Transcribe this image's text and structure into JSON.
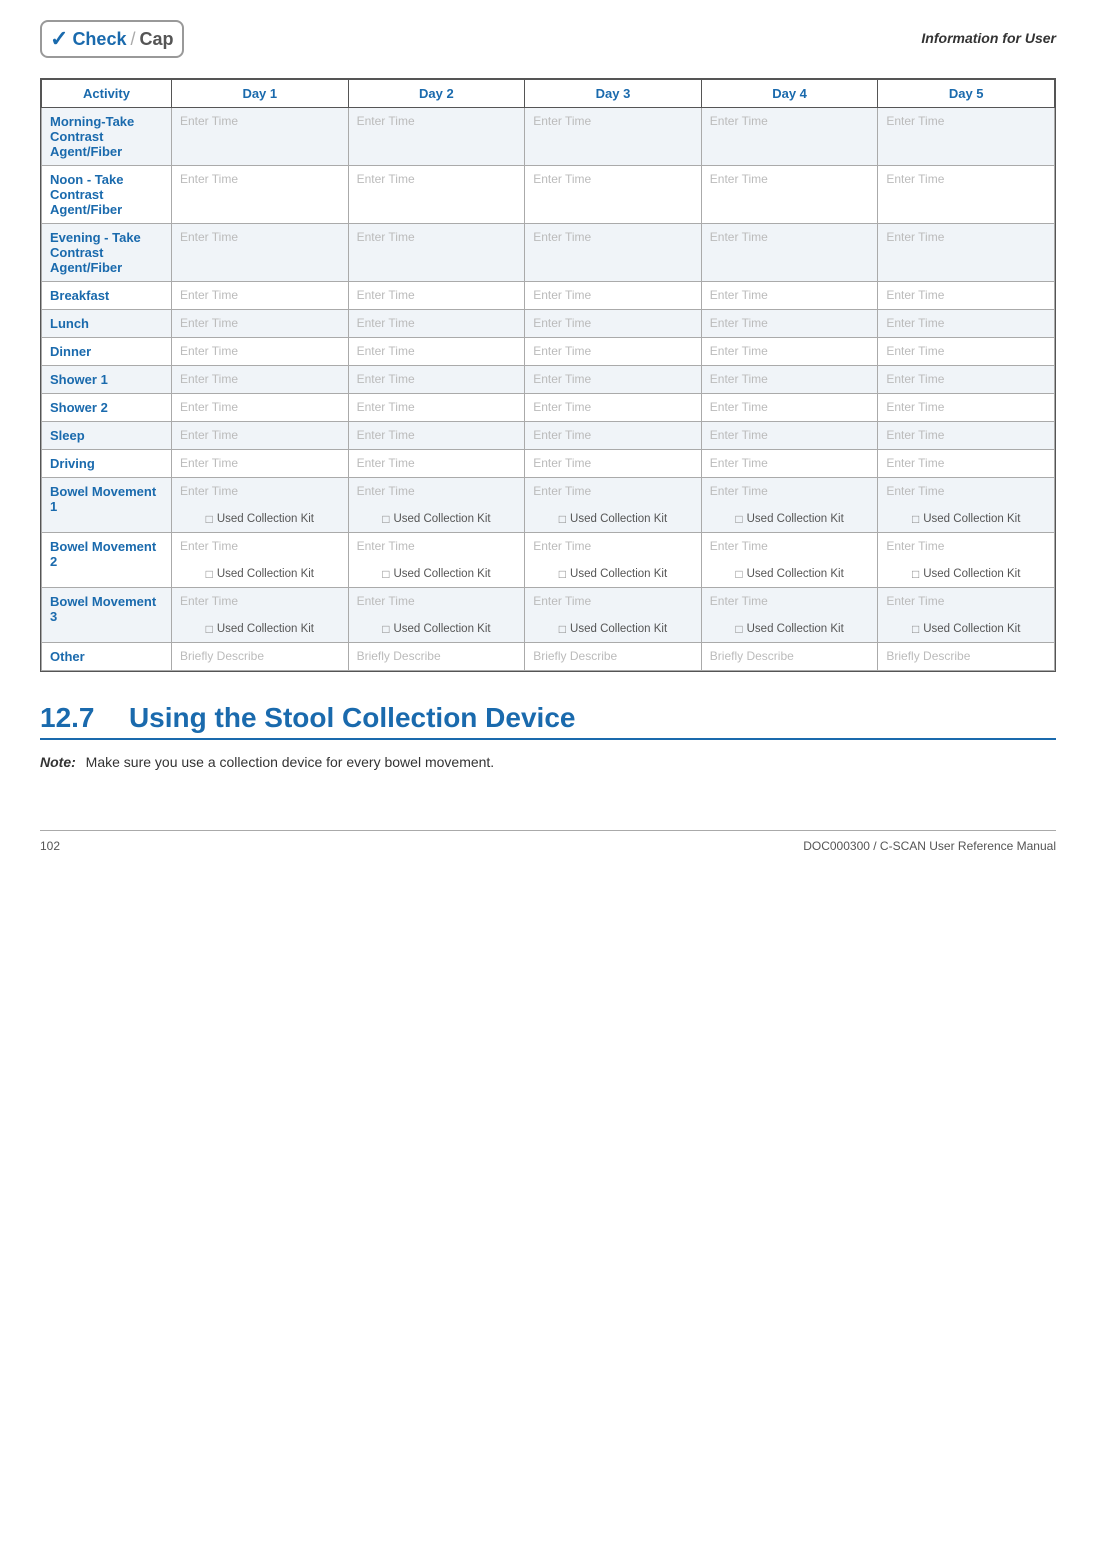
{
  "header": {
    "logo_check": "Check",
    "logo_cap": "Cap",
    "info_label": "Information for User"
  },
  "table": {
    "columns": [
      "Activity",
      "Day 1",
      "Day 2",
      "Day 3",
      "Day 4",
      "Day 5"
    ],
    "placeholder_time": "Enter Time",
    "placeholder_describe": "Briefly Describe",
    "checkbox_label": "Used Collection Kit",
    "rows": [
      {
        "activity": "Morning-Take Contrast Agent/Fiber",
        "shaded": true
      },
      {
        "activity": "Noon - Take Contrast Agent/Fiber",
        "shaded": false
      },
      {
        "activity": "Evening - Take Contrast Agent/Fiber",
        "shaded": true
      },
      {
        "activity": "Breakfast",
        "shaded": false
      },
      {
        "activity": "Lunch",
        "shaded": true
      },
      {
        "activity": "Dinner",
        "shaded": false
      },
      {
        "activity": "Shower 1",
        "shaded": true
      },
      {
        "activity": "Shower 2",
        "shaded": false
      },
      {
        "activity": "Sleep",
        "shaded": true
      },
      {
        "activity": "Driving",
        "shaded": false
      },
      {
        "activity": "Bowel Movement 1",
        "shaded": true,
        "has_checkbox": true
      },
      {
        "activity": "Bowel Movement 2",
        "shaded": false,
        "has_checkbox": true
      },
      {
        "activity": "Bowel Movement 3",
        "shaded": true,
        "has_checkbox": true
      },
      {
        "activity": "Other",
        "shaded": false,
        "is_describe": true
      }
    ]
  },
  "section": {
    "number": "12.7",
    "title": "Using the Stool Collection Device",
    "note_label": "Note:",
    "note_text": "Make sure you use a collection device for every bowel movement."
  },
  "footer": {
    "page": "102",
    "doc": "DOC000300 / C-SCAN User Reference Manual"
  }
}
